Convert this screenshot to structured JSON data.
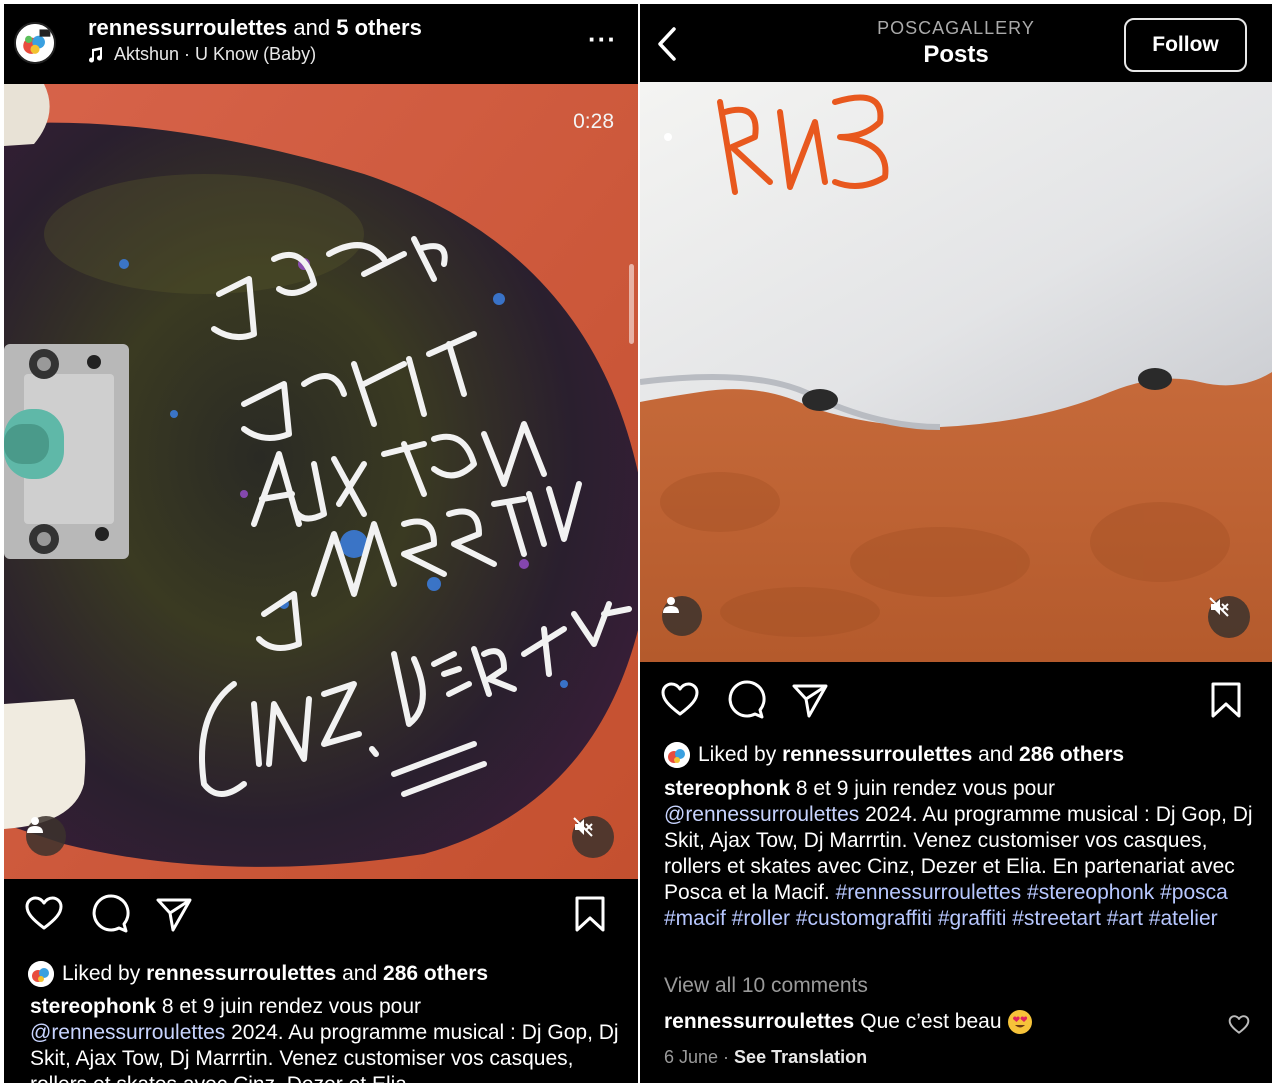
{
  "left_post": {
    "header": {
      "username": "rennessurroulettes",
      "collab_suffix": " and ",
      "collab_others": "5 others",
      "music": "Aktshun · U Know (Baby)",
      "more_label": "···"
    },
    "media": {
      "timer": "0:28"
    },
    "liked": {
      "prefix": "Liked by ",
      "user": "rennessurroulettes",
      "middle": " and ",
      "others": "286 others"
    },
    "caption": {
      "user": "stereophonk",
      "text_1": " 8 et 9 juin rendez vous pour ",
      "mention": "@rennessurroulettes",
      "text_2": " 2024. Au programme musical : Dj Gop, Dj Skit, Ajax Tow, Dj Marrrtin. Venez customiser vos casques, rollers et skates avec Cinz, Dezer et Elia."
    }
  },
  "right_post": {
    "header": {
      "account": "POSCAGALLERY",
      "title": "Posts",
      "follow_label": "Follow"
    },
    "liked": {
      "prefix": "Liked by ",
      "user": "rennessurroulettes",
      "middle": " and ",
      "others": "286 others"
    },
    "caption": {
      "user": "stereophonk",
      "text_1": " 8 et 9 juin rendez vous pour ",
      "mention": "@rennessurroulettes",
      "text_2": " 2024. Au programme musical : Dj Gop, Dj Skit, Ajax Tow, Dj Marrrtin. Venez customiser vos casques, rollers et skates avec Cinz, Dezer et Elia. En partenariat avec Posca et la Macif.",
      "hashtags": "#rennessurroulettes #stereophonk #posca #macif #roller #customgraffiti #graffiti #streetart #art #atelier"
    },
    "view_comments": "View all 10 comments",
    "comment": {
      "user": "rennessurroulettes",
      "text": " Que c’est beau"
    },
    "meta": {
      "date": "6 June",
      "separator": " · ",
      "translate": "See Translation"
    }
  },
  "colors": {
    "background": "#000000",
    "mention": "#c8d4ff",
    "muted": "#9a9a9a"
  }
}
